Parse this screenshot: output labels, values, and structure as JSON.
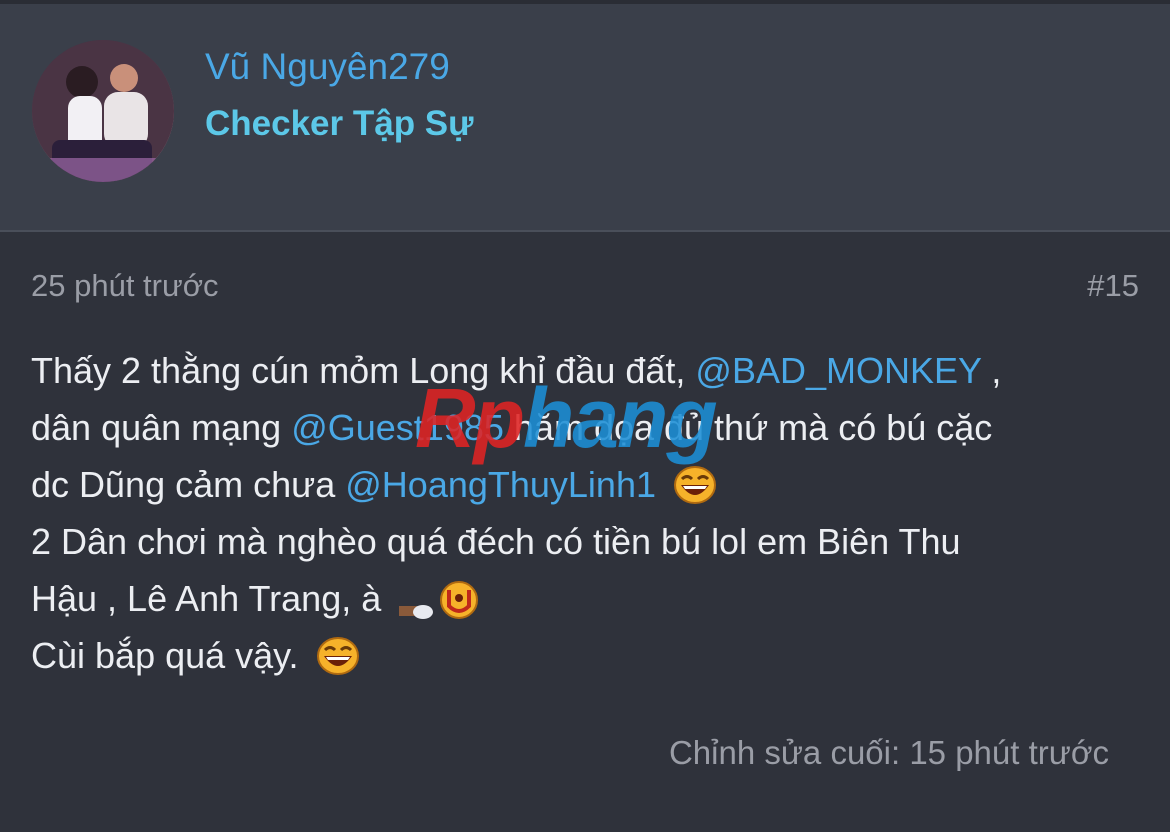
{
  "user": {
    "name": "Vũ Nguyên279",
    "title": "Checker Tập Sự",
    "avatar_icon": "avatar-photo"
  },
  "post": {
    "time": "25 phút trước",
    "number": "#15",
    "lines": [
      {
        "t1": "Thấy 2 thằng cún mỏm Long khỉ đầu đất, ",
        "m1": "@BAD_MONKEY",
        "t2": " ,"
      },
      {
        "t1": "dân quân mạng ",
        "m1": "@Guest1985",
        "t2": " hăm dọa đủ thứ mà có bú cặc"
      },
      {
        "t1": "dc Dũng cảm chưa ",
        "m1": "@HoangThuyLinh1",
        "t2": ""
      },
      {
        "t1": "2 Dân chơi mà nghèo quá đéch có tiền bú lol em Biên Thu",
        "m1": "",
        "t2": ""
      },
      {
        "t1": "Hậu , Lê Anh Trang, à ",
        "m1": "",
        "t2": ""
      },
      {
        "t1": "Cùi bắp quá vậy. ",
        "m1": "",
        "t2": ""
      }
    ],
    "edited": "Chỉnh sửa cuối: 15 phút trước"
  },
  "watermark": {
    "part1": "Rp",
    "part2": "hang"
  },
  "colors": {
    "background": "#2f323b",
    "header": "#3a3f4a",
    "username": "#4aa8e6",
    "usertitle": "#5cc8e8",
    "mention": "#4aa8e6",
    "meta": "#9a9da6",
    "text": "#eceef2"
  }
}
